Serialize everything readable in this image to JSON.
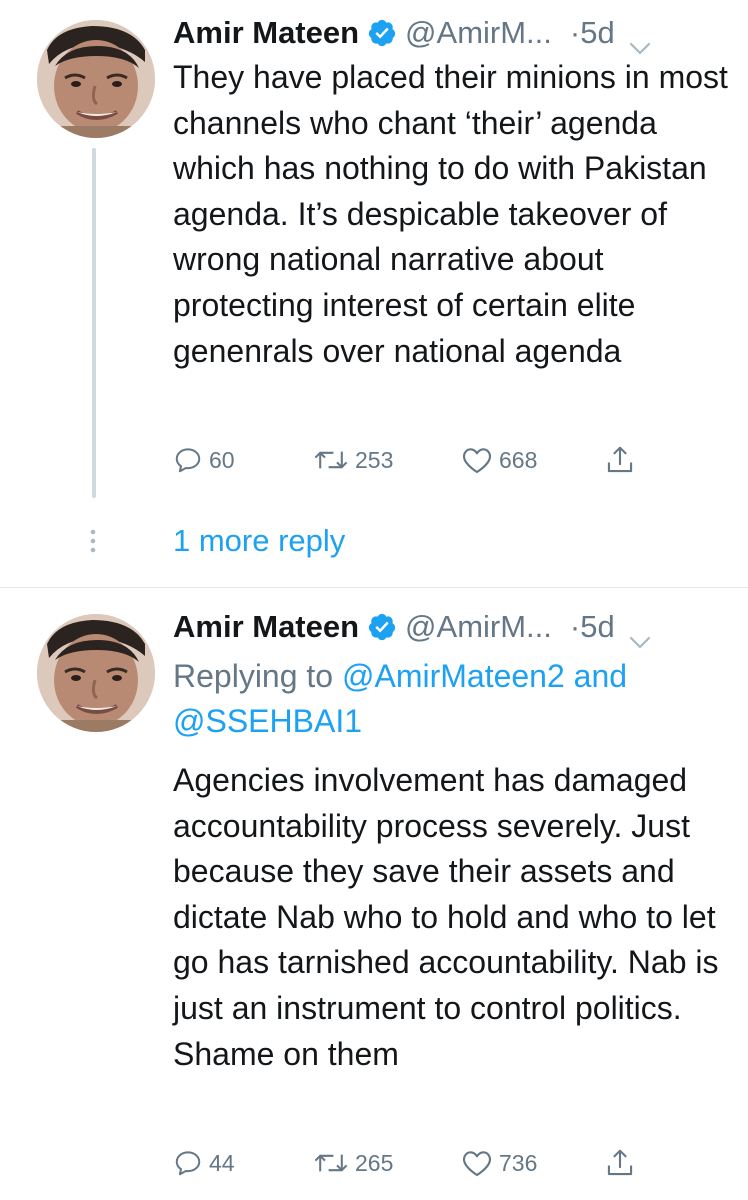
{
  "tweets": [
    {
      "author_name": "Amir Mateen",
      "handle": "@AmirM...",
      "time": "·5d",
      "text": "They have placed their minions in most channels who chant ‘their’ agenda which has nothing to do with Pakistan agenda. It’s despicable takeover of wrong national narrative about protecting interest of certain elite genenrals over national agenda",
      "replies": "60",
      "retweets": "253",
      "likes": "668",
      "more_replies": "1 more reply"
    },
    {
      "author_name": "Amir Mateen",
      "handle": "@AmirM...",
      "time": "·5d",
      "replying_prefix": "Replying to",
      "replying_mention_1": "@AmirMateen2",
      "replying_and": "and",
      "replying_mention_2": "@SSEHBAI1",
      "text": "Agencies involvement has damaged accountability process severely. Just because they save their assets and dictate Nab who to hold and who to let go has tarnished accountability. Nab is just an instrument to control politics. Shame on them",
      "replies": "44",
      "retweets": "265",
      "likes": "736"
    }
  ],
  "icons": {
    "verified": "verified-badge-icon",
    "caret": "chevron-down-icon",
    "reply": "reply-icon",
    "retweet": "retweet-icon",
    "like": "heart-icon",
    "share": "share-icon",
    "thread_more": "vertical-dots-icon"
  },
  "colors": {
    "accent": "#1da1f2",
    "text": "#14171a",
    "secondary": "#657786",
    "thread_line": "#cfd9de",
    "divider": "#e1e8ed"
  }
}
